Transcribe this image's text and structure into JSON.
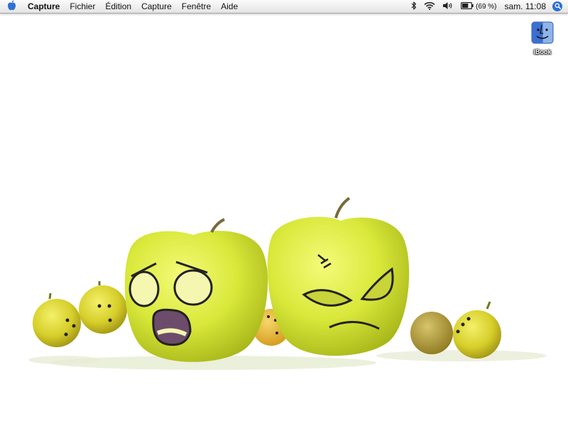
{
  "menubar": {
    "apple_icon": "apple-icon",
    "app_name": "Capture",
    "menus": [
      "Fichier",
      "Édition",
      "Capture",
      "Fenêtre",
      "Aide"
    ],
    "status": {
      "icons": [
        "bluetooth-icon",
        "wifi-icon",
        "volume-icon",
        "battery-icon"
      ],
      "battery_percent": "(69 %)",
      "battery_level": 0.69,
      "clock": "sam. 11:08",
      "spotlight_icon": "search-icon"
    }
  },
  "desktop": {
    "background_color": "#ffffff",
    "icons": [
      {
        "label": "iBook",
        "icon": "finder-icon"
      }
    ],
    "wallpaper": {
      "description_icon": "wallpaper-apples",
      "colors": {
        "apple": "#d9e83a",
        "small_fruit": "#e0c62a",
        "ink": "#222222"
      }
    }
  }
}
